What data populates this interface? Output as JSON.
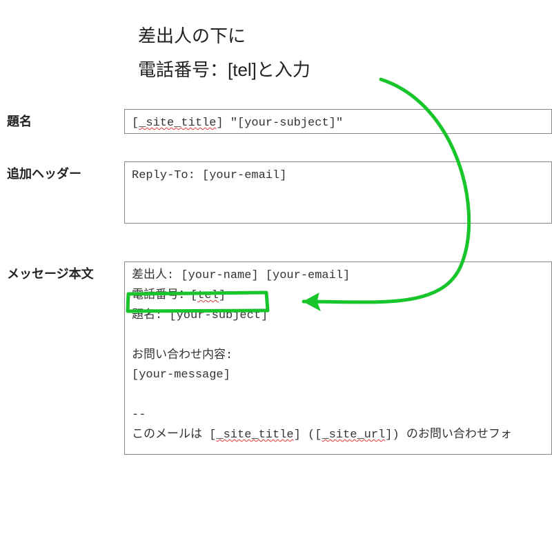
{
  "annotation": {
    "line1": "差出人の下に",
    "line2": "電話番号：[tel]と入力"
  },
  "form": {
    "subject": {
      "label": "題名",
      "value_prefix": "[",
      "value_site_title": "_site_title",
      "value_suffix": "] \"[your-subject]\""
    },
    "headers": {
      "label": "追加ヘッダー",
      "value": "Reply-To: [your-email]"
    },
    "body": {
      "label": "メッセージ本文",
      "line_from": "差出人: [your-name] [your-email]",
      "line_tel_prefix": "電話番号：[",
      "line_tel_tag": "tel",
      "line_tel_suffix": "]",
      "line_subject": "題名: [your-subject]",
      "line_inquiry_label": "お問い合わせ内容:",
      "line_message": "[your-message]",
      "line_sep": "-- ",
      "footer_a": "このメールは [",
      "footer_site_title": "_site_title",
      "footer_b": "] ([",
      "footer_site_url": "_site_url",
      "footer_c": "]) のお問い合わせフォ"
    }
  },
  "colors": {
    "annotation_green": "#18c52b"
  }
}
